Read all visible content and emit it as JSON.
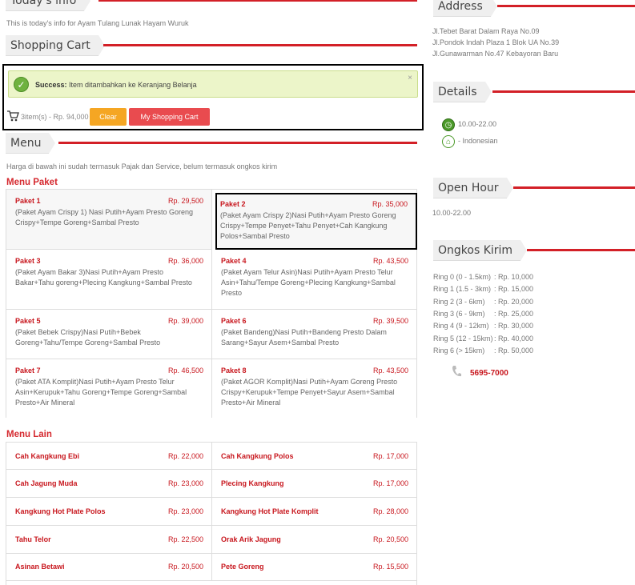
{
  "today_info": {
    "title": "Today's info",
    "text": "This is today's info for Ayam Tulang Lunak Hayam Wuruk"
  },
  "shopping_cart": {
    "title": "Shopping Cart",
    "alert_strong": "Success:",
    "alert_text": " Item ditambahkan ke Keranjang Belanja",
    "close": "×",
    "summary": "3item(s) - Rp. 94,000",
    "clear_label": "Clear",
    "my_cart_label": "My Shopping Cart"
  },
  "menu": {
    "title": "Menu",
    "note": "Harga di bawah ini sudah termasuk Pajak dan Service, belum termasuk ongkos kirim",
    "paket_title": "Menu Paket",
    "paket": [
      {
        "name": "Paket 1",
        "price": "Rp. 29,500",
        "desc": "(Paket Ayam Crispy 1) Nasi Putih+Ayam Presto Goreng Crispy+Tempe Goreng+Sambal Presto"
      },
      {
        "name": "Paket 2",
        "price": "Rp. 35,000",
        "desc": "(Paket Ayam Crispy 2)Nasi Putih+Ayam Presto Goreng Crispy+Tempe Penyet+Tahu Penyet+Cah Kangkung Polos+Sambal Presto"
      },
      {
        "name": "Paket 3",
        "price": "Rp. 36,000",
        "desc": "(Paket Ayam Bakar 3)Nasi Putih+Ayam Presto Bakar+Tahu goreng+Plecing Kangkung+Sambal Presto"
      },
      {
        "name": "Paket 4",
        "price": "Rp. 43,500",
        "desc": "(Paket Ayam Telur Asin)Nasi Putih+Ayam Presto Telur Asin+Tahu/Tempe Goreng+Plecing Kangkung+Sambal Presto"
      },
      {
        "name": "Paket 5",
        "price": "Rp. 39,000",
        "desc": "(Paket Bebek Crispy)Nasi Putih+Bebek Goreng+Tahu/Tempe Goreng+Sambal Presto"
      },
      {
        "name": "Paket 6",
        "price": "Rp. 39,500",
        "desc": "(Paket Bandeng)Nasi Putih+Bandeng Presto Dalam Sarang+Sayur Asem+Sambal Presto"
      },
      {
        "name": "Paket 7",
        "price": "Rp. 46,500",
        "desc": "(Paket ATA Komplit)Nasi Putih+Ayam Presto Telur Asin+Kerupuk+Tahu Goreng+Tempe Goreng+Sambal Presto+Air Mineral"
      },
      {
        "name": "Paket 8",
        "price": "Rp. 43,500",
        "desc": "(Paket AGOR Komplit)Nasi Putih+Ayam Goreng Presto Crispy+Kerupuk+Tempe Penyet+Sayur Asem+Sambal Presto+Air Mineral"
      }
    ],
    "lain_title": "Menu Lain",
    "lain": [
      {
        "name": "Cah Kangkung Ebi",
        "price": "Rp. 22,000"
      },
      {
        "name": "Cah Kangkung Polos",
        "price": "Rp. 17,000"
      },
      {
        "name": "Cah Jagung Muda",
        "price": "Rp. 23,000"
      },
      {
        "name": "Plecing Kangkung",
        "price": "Rp. 17,000"
      },
      {
        "name": "Kangkung Hot Plate Polos",
        "price": "Rp. 23,000"
      },
      {
        "name": "Kangkung Hot Plate Komplit",
        "price": "Rp. 28,000"
      },
      {
        "name": "Tahu Telor",
        "price": "Rp. 22,500"
      },
      {
        "name": "Orak Arik Jagung",
        "price": "Rp. 20,500"
      },
      {
        "name": "Asinan Betawi",
        "price": "Rp. 20,500"
      },
      {
        "name": "Pete Goreng",
        "price": "Rp. 15,500"
      }
    ]
  },
  "address": {
    "title": "Address",
    "lines": [
      "Jl.Tebet Barat Dalam Raya No.09",
      "Jl.Pondok Indah Plaza 1 Blok UA No.39",
      "Jl.Gunawarman No.47 Kebayoran Baru"
    ]
  },
  "details": {
    "title": "Details",
    "hours": "10.00-22.00",
    "cuisine": "- Indonesian"
  },
  "open_hour": {
    "title": "Open Hour",
    "text": "10.00-22.00"
  },
  "ongkos": {
    "title": "Ongkos Kirim",
    "rows": [
      {
        "label": "Ring 0 (0 - 1.5km)",
        "price": ": Rp. 10,000"
      },
      {
        "label": "Ring 1 (1.5 - 3km)",
        "price": ": Rp. 15,000"
      },
      {
        "label": "Ring 2 (3 - 6km)",
        "price": ": Rp. 20,000"
      },
      {
        "label": "Ring 3 (6 - 9km)",
        "price": ": Rp. 25,000"
      },
      {
        "label": "Ring 4 (9 - 12km)",
        "price": ": Rp. 30,000"
      },
      {
        "label": "Ring 5 (12 - 15km)",
        "price": ": Rp. 40,000"
      },
      {
        "label": "Ring 6 (> 15km)",
        "price": ": Rp. 50,000"
      }
    ],
    "phone": "5695-7000"
  },
  "colors": {
    "accent": "#d32027",
    "price": "#c8171e",
    "clear": "#f5a623",
    "cart_btn": "#e94b4f"
  }
}
